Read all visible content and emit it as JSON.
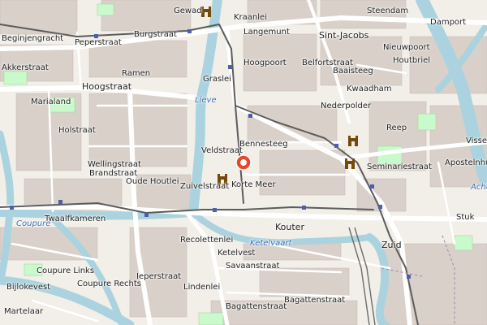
{
  "map": {
    "center_marker": "location-pin-icon",
    "colors": {
      "land": "#f2efe9",
      "blocks": "#d9d0c9",
      "water": "#aad3df",
      "park": "#c8facc",
      "road_major": "#ffffff",
      "rail": "#555555",
      "marker": "#e8472a"
    },
    "labels": {
      "steendam": "Steendam",
      "damport": "Damport",
      "beginjengracht": "Beginjengracht",
      "burgstraat": "Burgstraat",
      "gewad": "Gewad",
      "kraanlei": "Kraanlei",
      "langemunt": "Langemunt",
      "sint_jacobs": "Sint-Jacobs",
      "nieuwpoort": "Nieuwpoort",
      "akkerstraat": "Akkerstraat",
      "peperstraat": "Peperstraat",
      "hoogpoort": "Hoogpoort",
      "belfortstraat": "Belfortstraat",
      "baaisteeg": "Baaisteeg",
      "houtbriel": "Houtbriel",
      "hoogstraat": "Hoogstraat",
      "ramen": "Ramen",
      "graslei": "Graslei",
      "lieve": "Lieve",
      "nederpolder": "Nederpolder",
      "kwaadham": "Kwaadham",
      "reep": "Reep",
      "marialand": "Marialand",
      "holstraat": "Holstraat",
      "bennesteeg": "Bennesteeg",
      "wellingstraat": "Wellingstraat",
      "brandstraat": "Brandstraat",
      "veldstraat": "Veldstraat",
      "korte_meer": "Korte Meer",
      "seminariestraat": "Seminariestraat",
      "apostelnhuizen": "Apostelnhuizen",
      "visserij": "Visserij",
      "achterstraat": "Achterstraat",
      "oude_houtlei": "Oude Houtlei",
      "zuivelstraat": "Zuivelstraat",
      "twaalfkameren": "Twaalfkameren",
      "kouter": "Kouter",
      "stuk": "Stuk",
      "coupure": "Coupure",
      "recolettenlei": "Recolettenlei",
      "ketelvaart": "Ketelvaart",
      "zuid": "Zuid",
      "ketelvest": "Ketelvest",
      "coupure_links": "Coupure Links",
      "coupure_rechts": "Coupure Rechts",
      "ieperstraat": "Ieperstraat",
      "savaanstraat": "Savaanstraat",
      "lindenlei": "Lindenlei",
      "bijlokevest": "Bijlokevest",
      "martelaar": "Martelaar",
      "bagattenstraat": "Bagattenstraat",
      "bagattenstraat2": "Bagattenstraat"
    }
  }
}
